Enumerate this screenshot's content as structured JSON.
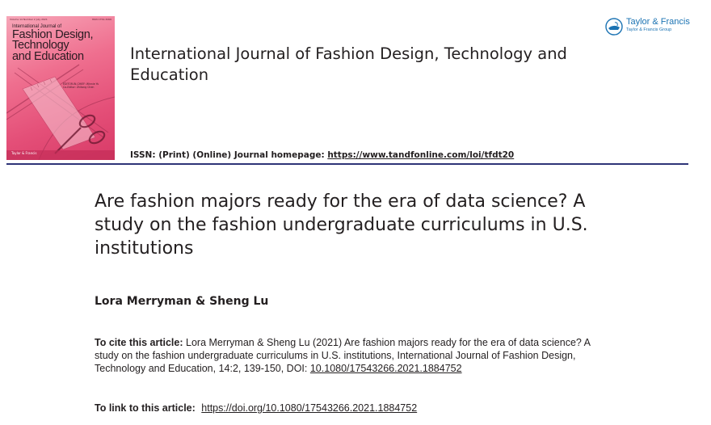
{
  "cover": {
    "top_left": "Volume 14 Number 2 July 2021",
    "top_right": "ISSN 1754-3266",
    "title_small": "International Journal of",
    "title_line1": "Fashion Design,",
    "title_line2": "Technology",
    "title_line3": "and Education",
    "meta_line1": "EDITOR-IN-CHIEF: Winnie Yu",
    "meta_line2": "Co-Editor: Zhitong Chen",
    "publisher": "Taylor & Francis",
    "colors": {
      "bg_light": "#f7a6b8",
      "bg_dark": "#d83a67"
    }
  },
  "journal": {
    "title": "International Journal of Fashion Design, Technology and Education",
    "issn_text": "ISSN: (Print) (Online) Journal homepage:",
    "homepage_url": "https://www.tandfonline.com/loi/tfdt20"
  },
  "publisher_logo": {
    "name": "Taylor & Francis",
    "group": "Taylor & Francis Group",
    "icon": "lamp-icon",
    "color": "#1b73b3"
  },
  "article": {
    "title": "Are fashion majors ready for the era of data science? A study on the fashion undergraduate curriculums in U.S. institutions",
    "authors": "Lora Merryman & Sheng Lu"
  },
  "citation": {
    "label": "To cite this article:",
    "text": "Lora Merryman & Sheng Lu (2021) Are fashion majors ready for the era of data science? A study on the fashion undergraduate curriculums in U.S. institutions, International Journal of Fashion Design, Technology and Education, 14:2, 139-150, DOI:",
    "doi": "10.1080/17543266.2021.1884752"
  },
  "link": {
    "label": "To link to this article:",
    "url": "https://doi.org/10.1080/17543266.2021.1884752"
  },
  "colors": {
    "rule": "#2e3478",
    "text": "#231f20"
  }
}
